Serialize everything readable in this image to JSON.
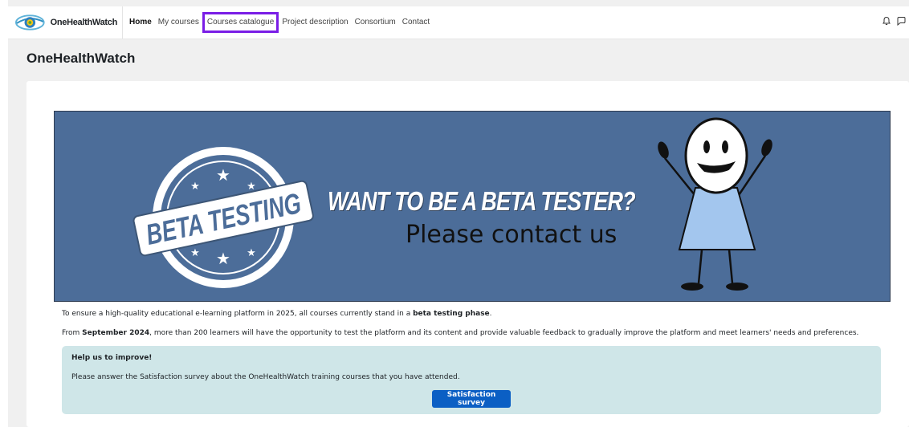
{
  "navbar": {
    "brand": "OneHealthWatch",
    "items": [
      {
        "label": "Home"
      },
      {
        "label": "My courses"
      },
      {
        "label": "Courses catalogue"
      },
      {
        "label": "Project description"
      },
      {
        "label": "Consortium"
      },
      {
        "label": "Contact"
      }
    ],
    "icons": [
      "bell-icon",
      "chat-icon"
    ],
    "highlight_color": "#7a1de6"
  },
  "page": {
    "title": "OneHealthWatch"
  },
  "banner": {
    "badge_text": "BETA TESTING",
    "headline": "WANT TO BE A BETA TESTER?",
    "subline": "Please contact us",
    "background": "#4c6d99"
  },
  "intro": {
    "p1_before": "To ensure a high-quality educational e-learning platform in 2025, all courses currently stand in a ",
    "p1_bold": "beta testing phase",
    "p1_after": ".",
    "p2_before": "From ",
    "p2_bold": "September 2024",
    "p2_after": ", more than 200 learners will have the opportunity to test the platform and its content and provide valuable feedback to gradually improve the platform and meet learners' needs and preferences."
  },
  "alert": {
    "title": "Help us to improve!",
    "text": "Please answer the Satisfaction survey about the OneHealthWatch training courses that you have attended.",
    "button_label": "Satisfaction survey",
    "background": "#cfe6e8",
    "button_color": "#0b5fc4"
  }
}
